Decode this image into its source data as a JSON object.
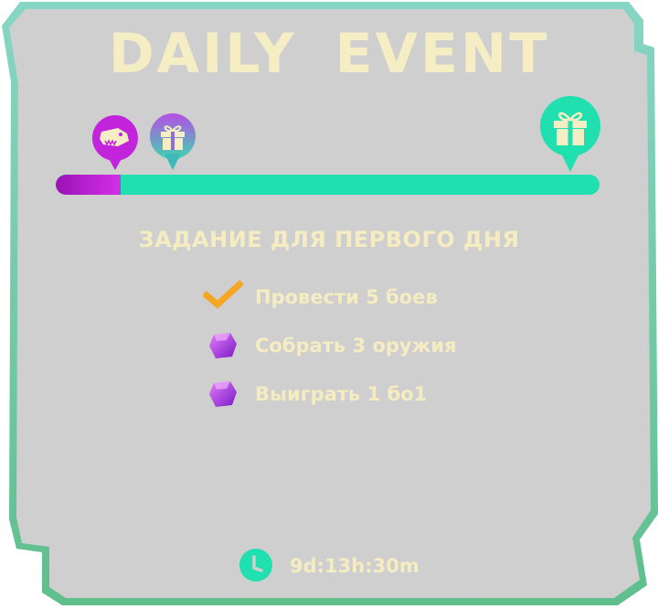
{
  "event": {
    "title": "DAILY  EVENT",
    "progress": 0.12,
    "colors": {
      "panel": "#cfcfcf",
      "frame": "#6fcfae",
      "accent_green": "#1fe0ae",
      "accent_purple": "#c224dc",
      "text_cream": "#f5edc4",
      "check_orange": "#f5a623"
    },
    "markers": [
      {
        "icon": "dino-head-icon",
        "state": "reached"
      },
      {
        "icon": "gift-icon",
        "state": "reached"
      },
      {
        "icon": "gift-icon",
        "state": "final"
      }
    ]
  },
  "tasks": {
    "heading": "ЗАДАНИЕ ДЛЯ ПЕРВОГО ДНЯ",
    "items": [
      {
        "label": "Провести 5 боев",
        "status": "done",
        "icon": "checkmark-icon"
      },
      {
        "label": "Собрать 3 оружия",
        "status": "pending",
        "icon": "purple-gem-icon"
      },
      {
        "label": "Выиграть 1 бо1",
        "status": "pending",
        "icon": "purple-gem-icon"
      }
    ]
  },
  "timer": {
    "icon": "clock-icon",
    "remaining": "9d:13h:30m"
  }
}
